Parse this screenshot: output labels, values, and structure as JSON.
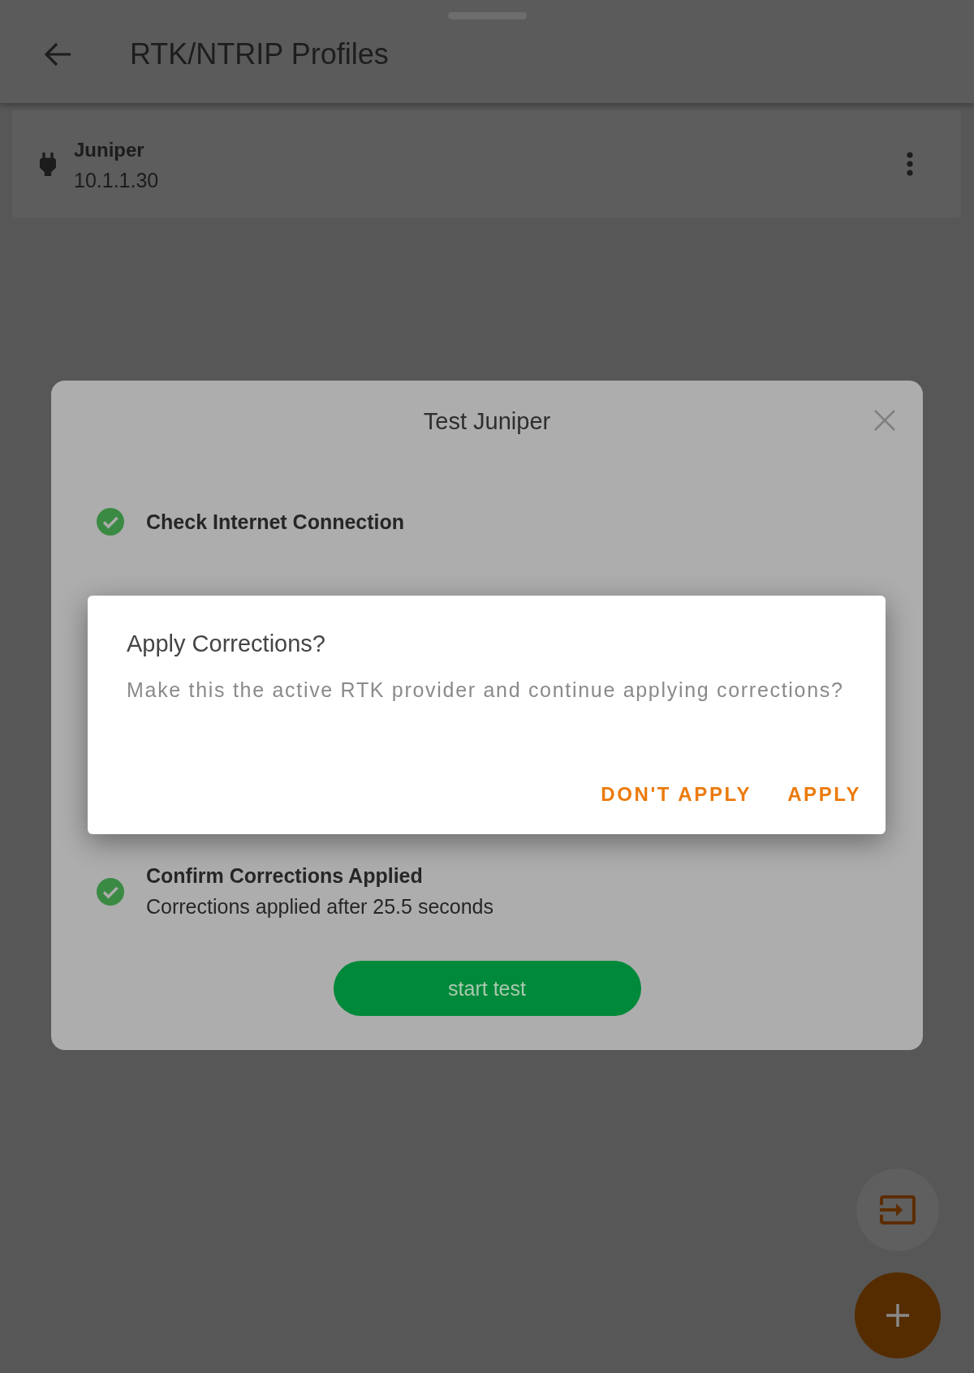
{
  "app_bar": {
    "title": "RTK/NTRIP Profiles"
  },
  "profiles": [
    {
      "name": "Juniper",
      "address": "10.1.1.30"
    }
  ],
  "test_dialog": {
    "title": "Test Juniper",
    "steps": [
      {
        "label": "Check Internet Connection",
        "passed": true
      },
      {
        "label": "Confirm Corrections Applied",
        "detail": "Corrections applied after 25.5 seconds",
        "passed": true
      }
    ],
    "button": "start test"
  },
  "alert_dialog": {
    "title": "Apply Corrections?",
    "message": "Make this the active RTK provider and continue applying corrections?",
    "buttons": [
      "DON'T APPLY",
      "APPLY"
    ]
  }
}
